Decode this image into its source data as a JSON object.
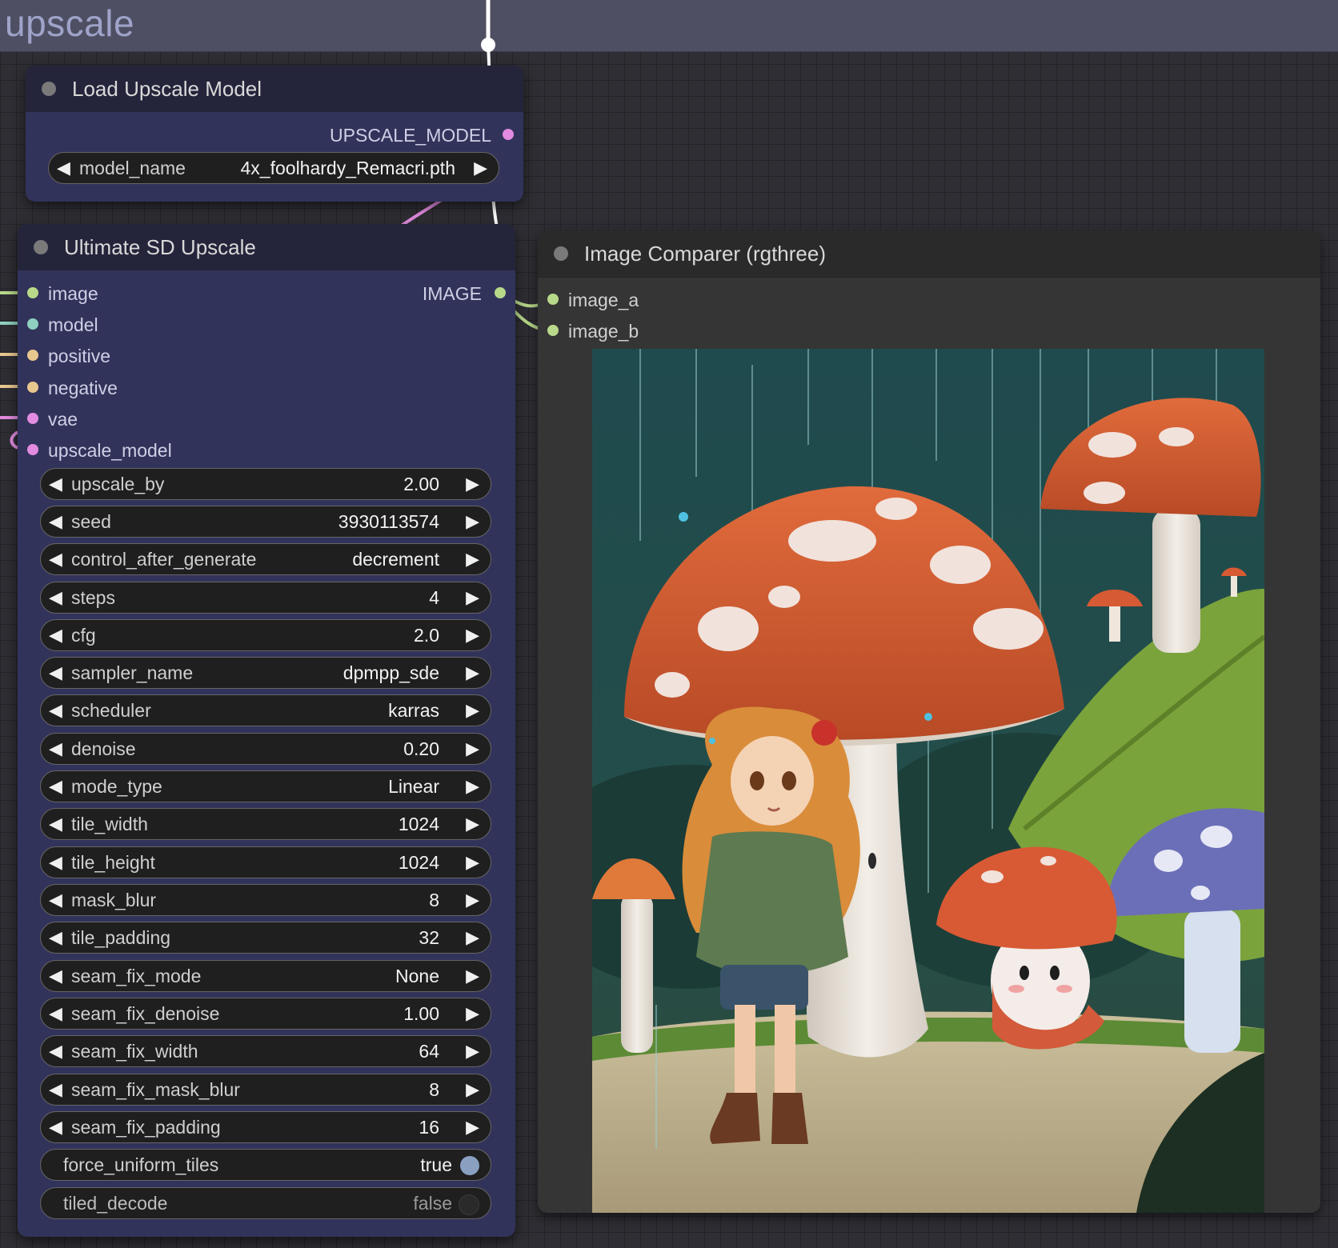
{
  "group": {
    "title": "upscale"
  },
  "load_upscale_model": {
    "title": "Load Upscale Model",
    "output_label": "UPSCALE_MODEL",
    "model_name": {
      "label": "model_name",
      "value": "4x_foolhardy_Remacri.pth"
    }
  },
  "ultimate_sd_upscale": {
    "title": "Ultimate SD Upscale",
    "output_label": "IMAGE",
    "inputs": [
      {
        "label": "image",
        "color": "#b8d98a"
      },
      {
        "label": "model",
        "color": "#8fd0c0"
      },
      {
        "label": "positive",
        "color": "#e8c78f"
      },
      {
        "label": "negative",
        "color": "#e8c78f"
      },
      {
        "label": "vae",
        "color": "#e28be0"
      },
      {
        "label": "upscale_model",
        "color": "#e28be0"
      }
    ],
    "widgets": [
      {
        "label": "upscale_by",
        "value": "2.00"
      },
      {
        "label": "seed",
        "value": "3930113574"
      },
      {
        "label": "control_after_generate",
        "value": "decrement"
      },
      {
        "label": "steps",
        "value": "4"
      },
      {
        "label": "cfg",
        "value": "2.0"
      },
      {
        "label": "sampler_name",
        "value": "dpmpp_sde"
      },
      {
        "label": "scheduler",
        "value": "karras"
      },
      {
        "label": "denoise",
        "value": "0.20"
      },
      {
        "label": "mode_type",
        "value": "Linear"
      },
      {
        "label": "tile_width",
        "value": "1024"
      },
      {
        "label": "tile_height",
        "value": "1024"
      },
      {
        "label": "mask_blur",
        "value": "8"
      },
      {
        "label": "tile_padding",
        "value": "32"
      },
      {
        "label": "seam_fix_mode",
        "value": "None"
      },
      {
        "label": "seam_fix_denoise",
        "value": "1.00"
      },
      {
        "label": "seam_fix_width",
        "value": "64"
      },
      {
        "label": "seam_fix_mask_blur",
        "value": "8"
      },
      {
        "label": "seam_fix_padding",
        "value": "16"
      }
    ],
    "toggles": [
      {
        "label": "force_uniform_tiles",
        "value": "true",
        "on": true
      },
      {
        "label": "tiled_decode",
        "value": "false",
        "on": false
      }
    ]
  },
  "image_comparer": {
    "title": "Image Comparer (rgthree)",
    "inputs": [
      {
        "label": "image_a",
        "color": "#b8d98a"
      },
      {
        "label": "image_b",
        "color": "#b8d98a"
      }
    ]
  },
  "colors": {
    "image_slot": "#b8d98a",
    "model_slot": "#8fd0c0",
    "conditioning_slot": "#e8c78f",
    "vae_slot": "#e28be0",
    "toggle_on": "#8aa0c0",
    "toggle_off": "#2a2a2a"
  }
}
